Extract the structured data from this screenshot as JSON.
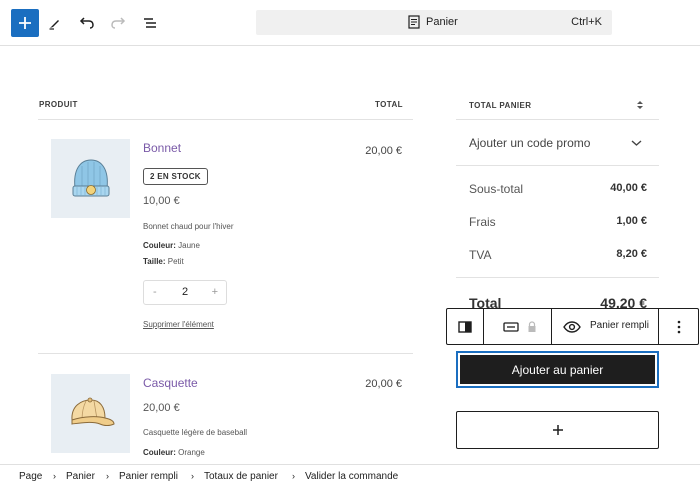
{
  "toolbar": {
    "add_icon": "plus-icon",
    "tools_icon": "pencil-icon",
    "undo_icon": "undo-icon",
    "redo_icon": "redo-icon",
    "outline_icon": "list-view-icon",
    "command_label": "Panier",
    "command_shortcut": "Ctrl+K"
  },
  "cart": {
    "col_product": "PRODUIT",
    "col_total": "TOTAL",
    "items": [
      {
        "name": "Bonnet",
        "badge": "2 EN STOCK",
        "price": "10,00 €",
        "description": "Bonnet chaud pour l'hiver",
        "attr1_label": "Couleur:",
        "attr1_value": " Jaune",
        "attr2_label": "Taille:",
        "attr2_value": " Petit",
        "qty_minus": "-",
        "quantity": "2",
        "qty_plus": "+",
        "remove": "Supprimer l'élément",
        "total": "20,00 €"
      },
      {
        "name": "Casquette",
        "price": "20,00 €",
        "description": "Casquette légère de baseball",
        "attr1_label": "Couleur:",
        "attr1_value": " Orange",
        "total": "20,00 €"
      }
    ]
  },
  "totals": {
    "heading": "TOTAL PANIER",
    "promo": "Ajouter un code promo",
    "subtotal_label": "Sous-total",
    "subtotal": "40,00 €",
    "fees_label": "Frais",
    "fees": "1,00 €",
    "tax_label": "TVA",
    "tax": "8,20 €",
    "total_label": "Total",
    "total": "49,20 €"
  },
  "block_toolbar": {
    "view_label": "Panier rempli"
  },
  "add_to_cart": "Ajouter au panier",
  "appender_icon": "plus-icon",
  "breadcrumb": [
    "Page",
    "Panier",
    "Panier rempli",
    "Totaux de panier",
    "Valider la commande"
  ],
  "colors": {
    "accent": "#1a6ec0",
    "product_link": "#7a5aa8",
    "button_dark": "#1e1e1e"
  }
}
